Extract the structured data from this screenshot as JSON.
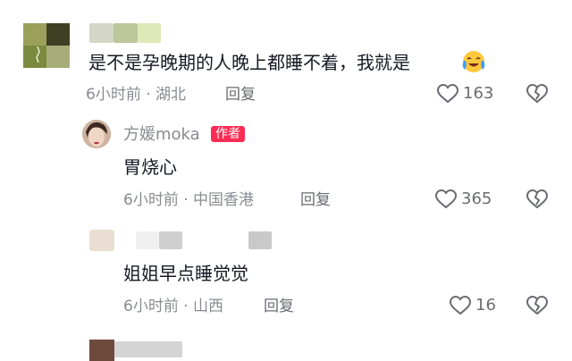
{
  "comments": [
    {
      "text": "是不是孕晚期的人晚上都睡不着，我就是",
      "time": "6小时前",
      "location": "湖北",
      "reply_label": "回复",
      "likes": "163",
      "emoji_icon": "crying-laughing-emoji-icon"
    },
    {
      "username": "方媛moka",
      "badge": "作者",
      "text": "胃烧心",
      "time": "6小时前",
      "location": "中国香港",
      "reply_label": "回复",
      "likes": "365"
    },
    {
      "text": "姐姐早点睡觉觉",
      "time": "6小时前",
      "location": "山西",
      "reply_label": "回复",
      "likes": "16"
    }
  ],
  "separator": "·",
  "colors": {
    "text": "#161823",
    "meta": "#8a8b91",
    "badge": "#fe2c55"
  }
}
